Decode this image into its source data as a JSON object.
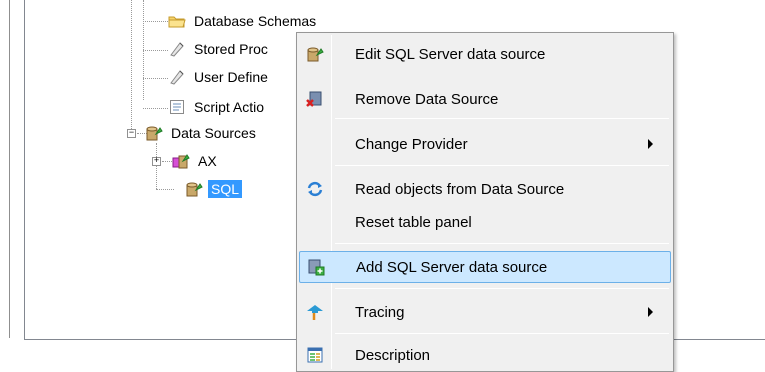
{
  "tree": {
    "items": [
      {
        "label": "Database Schemas",
        "icon": "folder-icon"
      },
      {
        "label": "Stored Proc",
        "icon": "stored-procedure-icon"
      },
      {
        "label": "User Define",
        "icon": "user-defined-icon"
      },
      {
        "label": "Script Actio",
        "icon": "script-action-icon"
      },
      {
        "label": "Data Sources",
        "icon": "data-sources-icon",
        "expander": "−"
      },
      {
        "label": "AX",
        "icon": "ax-datasource-icon",
        "expander": "+"
      },
      {
        "label": "SQL",
        "icon": "sql-datasource-icon",
        "selected": true
      }
    ]
  },
  "context_menu": {
    "items": [
      {
        "label": "Edit SQL Server data source",
        "icon": "edit-datasource-icon"
      },
      {
        "label": "Remove Data Source",
        "icon": "remove-datasource-icon"
      },
      {
        "label": "Change Provider",
        "submenu": true
      },
      {
        "label": "Read objects from Data Source",
        "icon": "refresh-icon"
      },
      {
        "label": "Reset table panel"
      },
      {
        "label": "Add SQL Server data source",
        "icon": "add-datasource-icon",
        "highlighted": true
      },
      {
        "label": "Tracing",
        "icon": "tracing-icon",
        "submenu": true
      },
      {
        "label": "Description",
        "icon": "description-icon"
      }
    ]
  },
  "colors": {
    "selection": "#3399ff",
    "menu_background": "#f0f0f0",
    "menu_highlight": "#cce8ff",
    "menu_highlight_border": "#6cb0e8"
  }
}
